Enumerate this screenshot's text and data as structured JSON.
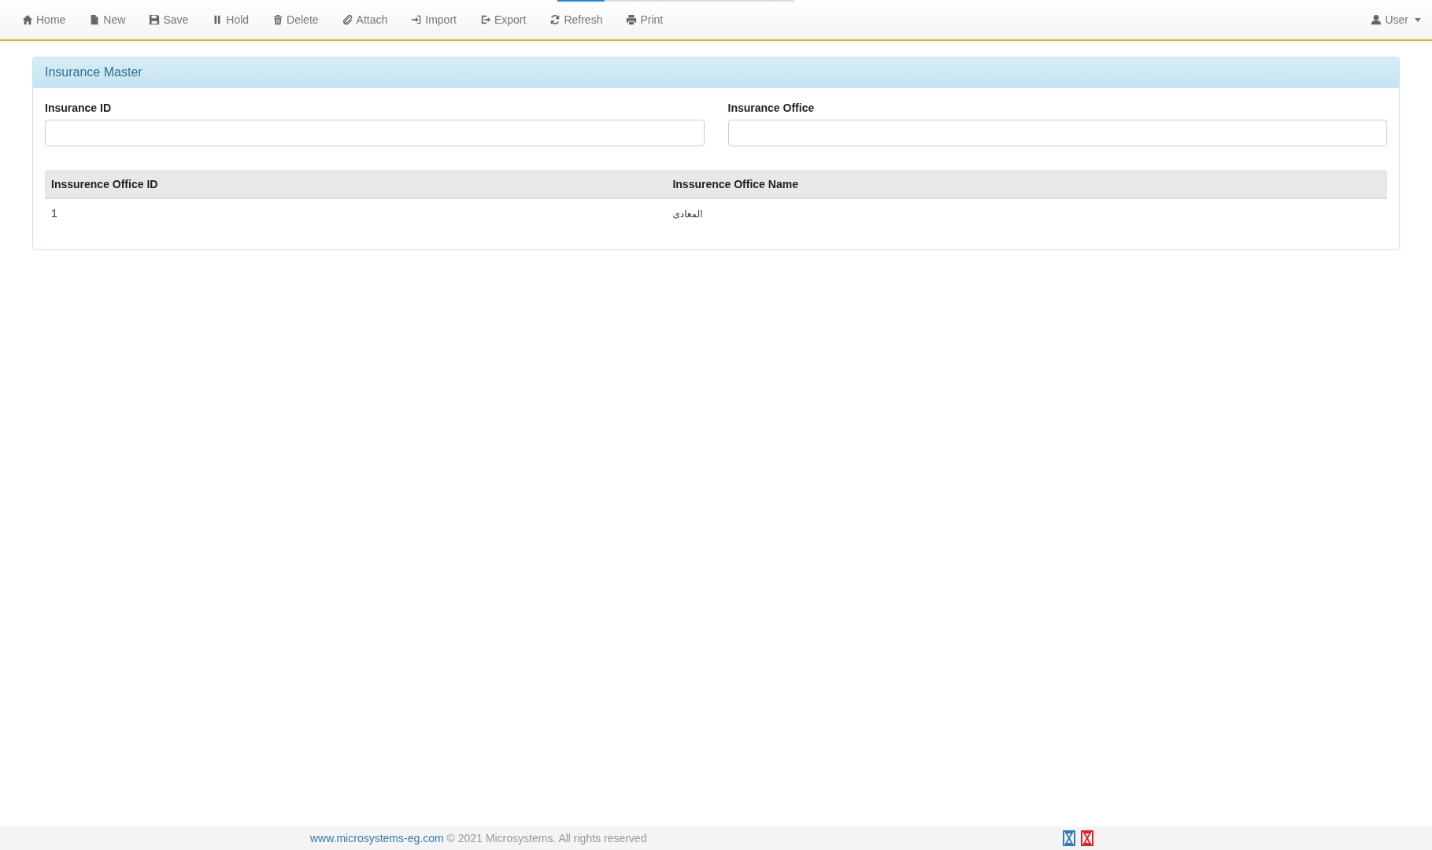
{
  "loading_bar": {
    "level": 0.2
  },
  "toolbar": {
    "items": [
      {
        "label": "Home"
      },
      {
        "label": "New"
      },
      {
        "label": "Save"
      },
      {
        "label": "Hold"
      },
      {
        "label": "Delete"
      },
      {
        "label": "Attach"
      },
      {
        "label": "Import"
      },
      {
        "label": "Export"
      },
      {
        "label": "Refresh"
      },
      {
        "label": "Print"
      }
    ],
    "user_menu": {
      "label": "User"
    }
  },
  "panel": {
    "title": "Insurance Master",
    "fields": [
      {
        "label": "Insurance ID"
      },
      {
        "label": "Insurance Office"
      }
    ],
    "table": {
      "columns": [
        "Inssurence Office ID",
        "Inssurence Office Name"
      ],
      "rows": [
        [
          "1",
          "المعادى"
        ]
      ]
    }
  },
  "footer": {
    "link": "www.microsystems-eg.com",
    "text": "© 2021 Microsystems. All rights reserved",
    "buttons": [
      {
        "color": "#337ab7"
      },
      {
        "color": "#e52222"
      }
    ]
  }
}
